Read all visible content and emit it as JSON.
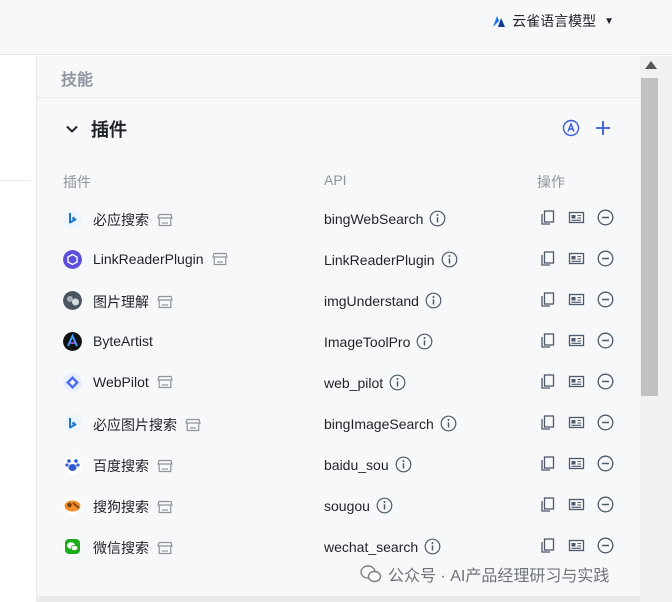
{
  "topbar": {
    "model_label": "云雀语言模型"
  },
  "panel": {
    "section_title": "技能",
    "plugin_title": "插件",
    "columns": {
      "plugin": "插件",
      "api": "API",
      "ops": "操作"
    },
    "rows": [
      {
        "name": "必应搜索",
        "api": "bingWebSearch",
        "icon": "bing-icon",
        "store": true
      },
      {
        "name": "LinkReaderPlugin",
        "api": "LinkReaderPlugin",
        "icon": "link-reader-icon",
        "store": true
      },
      {
        "name": "图片理解",
        "api": "imgUnderstand",
        "icon": "image-understand-icon",
        "store": true
      },
      {
        "name": "ByteArtist",
        "api": "ImageToolPro",
        "icon": "byteartist-icon",
        "store": false
      },
      {
        "name": "WebPilot",
        "api": "web_pilot",
        "icon": "webpilot-icon",
        "store": true
      },
      {
        "name": "必应图片搜索",
        "api": "bingImageSearch",
        "icon": "bing-icon",
        "store": true
      },
      {
        "name": "百度搜索",
        "api": "baidu_sou",
        "icon": "baidu-icon",
        "store": true
      },
      {
        "name": "搜狗搜索",
        "api": "sougou",
        "icon": "sougou-icon",
        "store": true
      },
      {
        "name": "微信搜索",
        "api": "wechat_search",
        "icon": "wechat-icon",
        "store": true
      }
    ]
  },
  "watermark": {
    "text": "公众号 · AI产品经理研习与实践"
  },
  "colors": {
    "accent": "#3b5bdb",
    "muted": "#8f959e",
    "panel_bg": "#f7f8fa"
  }
}
